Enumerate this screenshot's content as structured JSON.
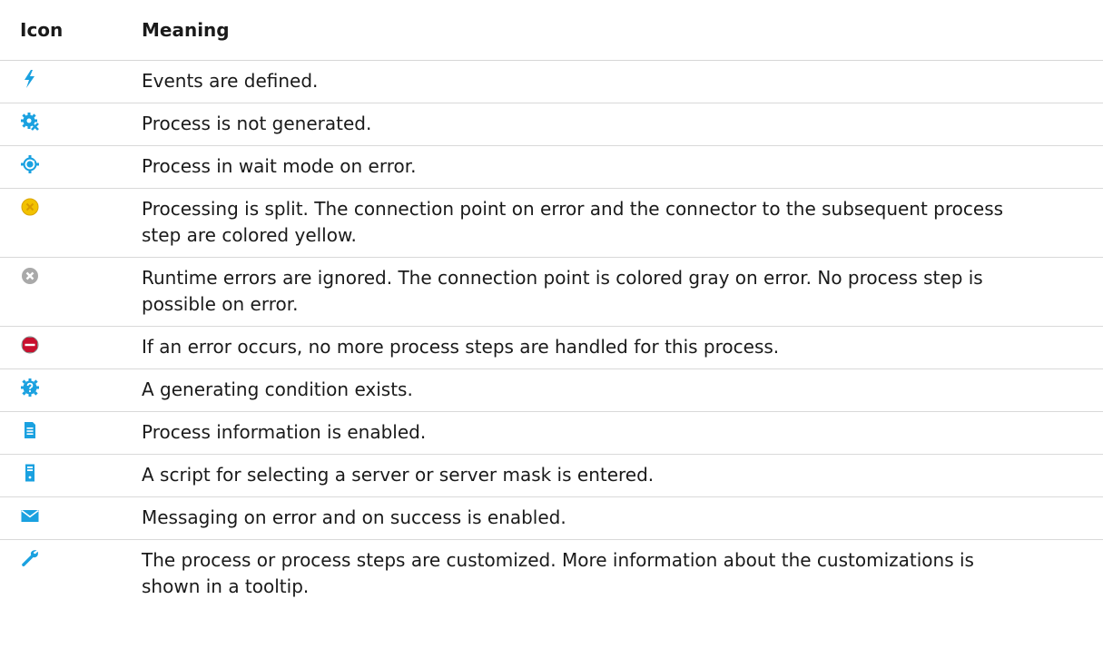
{
  "header": {
    "icon_label": "Icon",
    "meaning_label": "Meaning"
  },
  "rows": [
    {
      "icon": "lightning-bolt-icon",
      "meaning": "Events are defined."
    },
    {
      "icon": "gear-with-x-icon",
      "meaning": "Process is not generated."
    },
    {
      "icon": "gear-refresh-icon",
      "meaning": "Process in wait mode on error."
    },
    {
      "icon": "yellow-split-circle-icon",
      "meaning": "Processing is split. The connection point on error and the connector to the subsequent process step are colored yellow."
    },
    {
      "icon": "gray-x-circle-icon",
      "meaning": "Runtime errors are ignored. The connection point is colored gray on error. No process step is possible on error."
    },
    {
      "icon": "stop-sign-icon",
      "meaning": "If an error occurs, no more process steps are handled for this process."
    },
    {
      "icon": "gear-question-icon",
      "meaning": "A generating condition exists."
    },
    {
      "icon": "document-icon",
      "meaning": "Process information is enabled."
    },
    {
      "icon": "server-icon",
      "meaning": "A script for selecting a server or server mask is entered."
    },
    {
      "icon": "envelope-icon",
      "meaning": "Messaging on error and on success is enabled."
    },
    {
      "icon": "wrench-icon",
      "meaning": "The process or process steps are customized. More information about the customizations is shown in a tooltip."
    }
  ],
  "colors": {
    "icon_blue": "#1aa1e0",
    "yellow": "#f2c200",
    "gray": "#a9a9a9",
    "stop_red": "#c8102e",
    "divider": "#d9d9d9"
  }
}
